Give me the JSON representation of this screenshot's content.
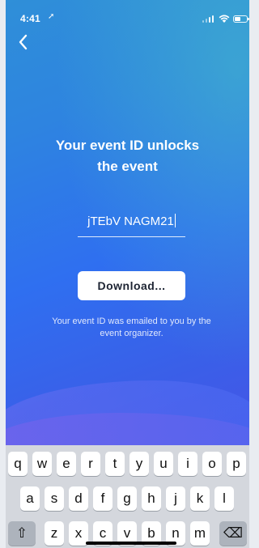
{
  "status": {
    "time": "4:41",
    "location_arrow": "➚"
  },
  "header": {
    "back_icon": "chevron-left-icon"
  },
  "main": {
    "title_line1": "Your event ID unlocks",
    "title_line2": "the event",
    "event_id_value": "jTEbV NAGM21",
    "download_label": "Download...",
    "helper_text": "Your event ID was emailed to you by the event organizer."
  },
  "keyboard": {
    "row1": [
      "q",
      "w",
      "e",
      "r",
      "t",
      "y",
      "u",
      "i",
      "o",
      "p"
    ],
    "row2": [
      "a",
      "s",
      "d",
      "f",
      "g",
      "h",
      "j",
      "k",
      "l"
    ],
    "row3": [
      "z",
      "x",
      "c",
      "v",
      "b",
      "n",
      "m"
    ],
    "shift_icon": "⇧",
    "backspace_icon": "⌫"
  },
  "colors": {
    "accent_top": "#2f8fd8",
    "accent_bottom": "#4753e6",
    "keyboard_bg": "#d4d7dd"
  }
}
